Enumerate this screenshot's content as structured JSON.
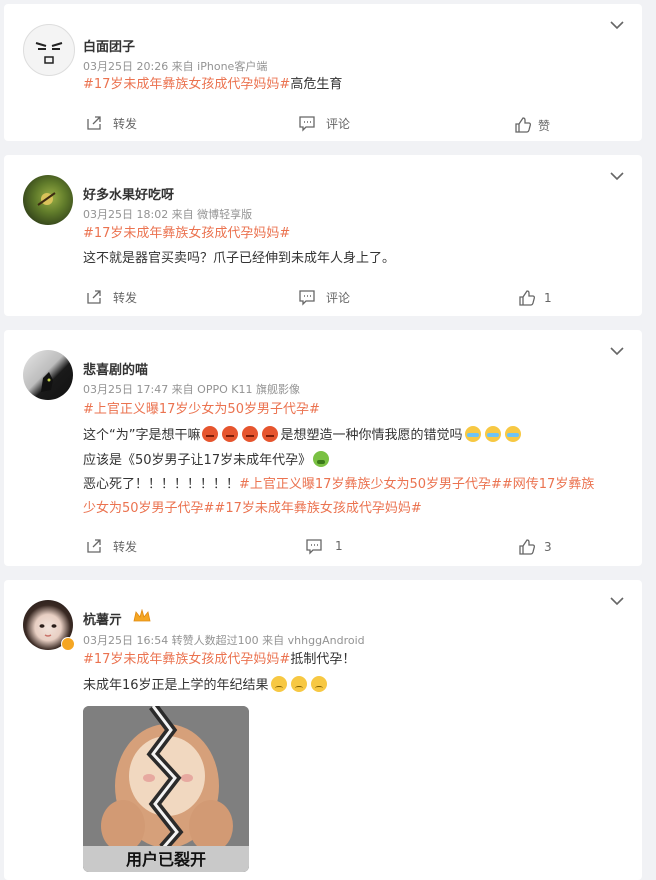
{
  "comments": [
    {
      "username": "白面团子",
      "meta": "03月25日 20:26  来自 iPhone客户端",
      "lines": [
        [
          {
            "t": "#17岁未成年彝族女孩成代孕妈妈#",
            "tag": true
          },
          {
            "t": "高危生育"
          }
        ]
      ],
      "repost_label": "转发",
      "comment_label": "评论",
      "like_label": "赞"
    },
    {
      "username": "好多水果好吃呀",
      "meta": "03月25日 18:02  来自 微博轻享版",
      "lines": [
        [
          {
            "t": "#17岁未成年彝族女孩成代孕妈妈#",
            "tag": true
          }
        ],
        [
          {
            "t": "这不就是器官买卖吗？爪子已经伸到未成年人身上了。"
          }
        ]
      ],
      "repost_label": "转发",
      "comment_label": "评论",
      "like_label": "1"
    },
    {
      "username": "悲喜剧的喵",
      "meta": "03月25日 17:47  来自 OPPO K11 旗舰影像",
      "lines": [
        [
          {
            "t": "#上官正义曝17岁少女为50岁男子代孕#",
            "tag": true
          }
        ],
        [
          {
            "t": "这个“为”字是想干嘛"
          },
          {
            "emo": "angry"
          },
          {
            "emo": "angry"
          },
          {
            "emo": "angry"
          },
          {
            "emo": "angry"
          },
          {
            "t": "是想塑造一种你情我愿的错觉吗"
          },
          {
            "emo": "cry"
          },
          {
            "emo": "cry"
          },
          {
            "emo": "cry"
          }
        ],
        [
          {
            "t": "应该是《50岁男子让17岁未成年代孕》"
          },
          {
            "emo": "sick"
          }
        ],
        [
          {
            "t": "恶心死了！！！！！！！！"
          },
          {
            "t": "#上官正义曝17岁彝族少女为50岁男子代孕##网传17岁彝族",
            "tag": true
          }
        ],
        [
          {
            "t": "少女为50岁男子代孕##17岁未成年彝族女孩成代孕妈妈#",
            "tag": true
          }
        ]
      ],
      "repost_label": "转发",
      "comment_label": "1",
      "like_label": "3"
    },
    {
      "username": "杭薯亓",
      "meta": "03月25日 16:54  转赞人数超过100  来自 vhhggAndroid",
      "lines": [
        [
          {
            "t": "#17岁未成年彝族女孩成代孕妈妈#",
            "tag": true
          },
          {
            "t": "抵制代孕！"
          }
        ],
        [
          {
            "t": "未成年16岁正是上学的年纪结果"
          },
          {
            "emo": "sad"
          },
          {
            "emo": "sad"
          },
          {
            "emo": "sad"
          }
        ]
      ],
      "image_caption": "用户已裂开"
    }
  ],
  "colors": {
    "tag": "#eb7350",
    "text": "#333333",
    "meta": "#939393",
    "bg": "#f1f2f5"
  }
}
